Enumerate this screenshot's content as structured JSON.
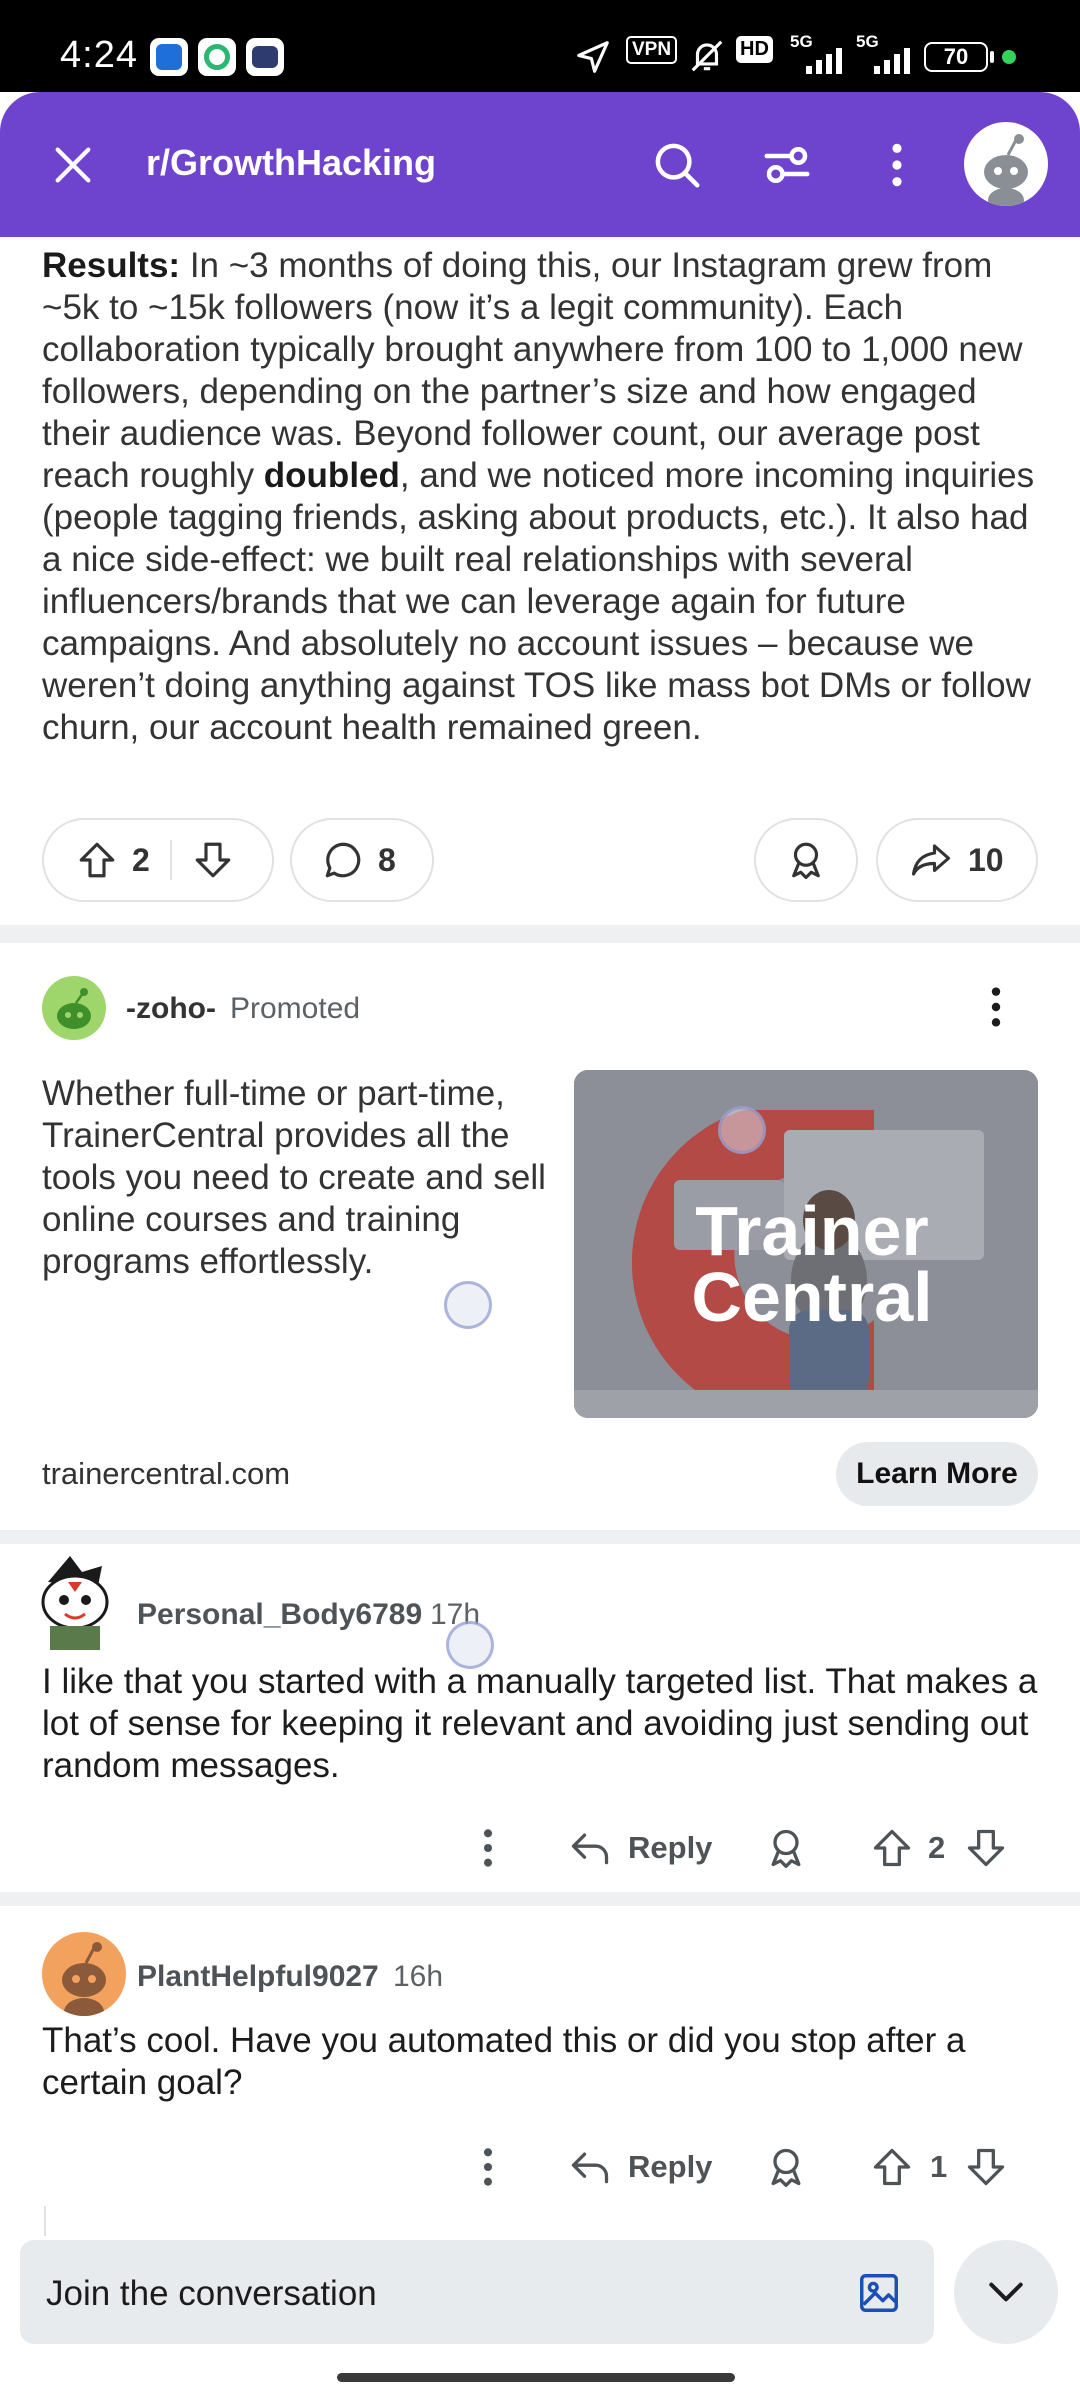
{
  "status_bar": {
    "time": "4:24",
    "vpn": "VPN",
    "hd": "HD",
    "net1": "5G",
    "net2": "5G",
    "battery": "70"
  },
  "header": {
    "title": "r/GrowthHacking"
  },
  "post": {
    "results_label": "Results:",
    "text_before_bold": " In ~3 months of doing this, our Instagram grew from ~5k to ~15k followers (now it’s a legit community). Each collaboration typically brought anywhere from 100 to 1,000 new followers, depending on the partner’s size and how engaged their audience was. Beyond follower count, our average post reach roughly ",
    "bold_word": "doubled",
    "text_after_bold": ", and we noticed more incoming inquiries (people tagging friends, asking about products, etc.). It also had a nice side-effect: we built real relationships with several influencers/brands that we can leverage again for future campaigns. And absolutely no account issues – because we weren’t doing anything against TOS like mass bot DMs or follow churn, our account health remained green.",
    "upvotes": "2",
    "comments": "8",
    "shares": "10"
  },
  "ad": {
    "author": "-zoho-",
    "promoted_label": "Promoted",
    "text": "Whether full-time or part-time, TrainerCentral provides all the tools you need to create and sell online courses and training programs effortlessly.",
    "image_text_line1": "Trainer",
    "image_text_line2": "Central",
    "domain": "trainercentral.com",
    "cta": "Learn More"
  },
  "comments": [
    {
      "user": "Personal_Body6789",
      "time": "17h",
      "body": "I like that you started with a manually targeted list. That makes a lot of sense for keeping it relevant and avoiding just sending out random messages.",
      "reply_label": "Reply",
      "votes": "2"
    },
    {
      "user": "PlantHelpful9027",
      "time": "16h",
      "body": "That’s cool. Have you automated this or did you stop after a certain goal?",
      "reply_label": "Reply",
      "votes": "1"
    }
  ],
  "composer": {
    "placeholder": "Join the conversation"
  },
  "colors": {
    "header_bg": "#6e44cf",
    "status_bar_bg": "#000000",
    "band": "#eef0f2"
  },
  "icons": [
    "close-icon",
    "search-icon",
    "filter-icon",
    "more-vertical-icon",
    "user-avatar-icon",
    "upvote-icon",
    "downvote-icon",
    "comment-icon",
    "award-icon",
    "share-icon",
    "reply-icon",
    "image-icon",
    "chevron-down-icon"
  ]
}
